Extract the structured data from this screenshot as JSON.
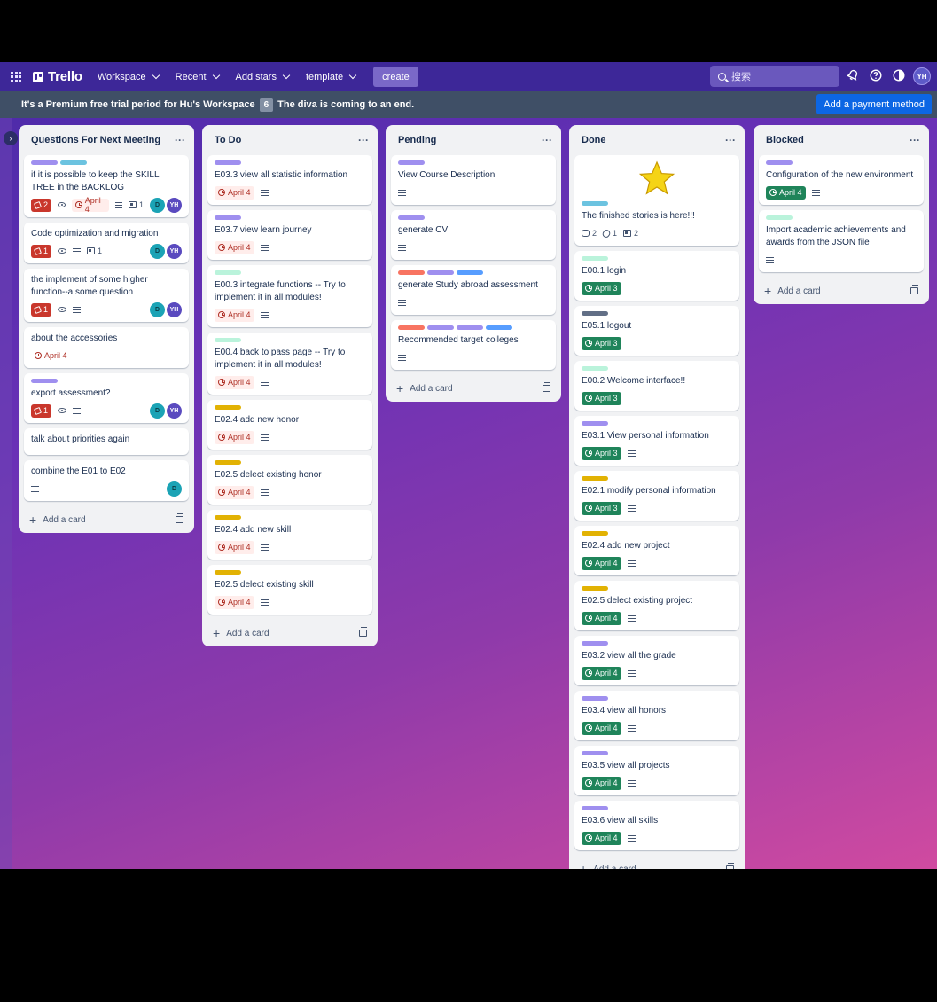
{
  "nav": {
    "logo": "Trello",
    "menu": [
      {
        "label": "Workspace"
      },
      {
        "label": "Recent"
      },
      {
        "label": "Add stars"
      },
      {
        "label": "template"
      }
    ],
    "create_label": "create",
    "search_placeholder": "搜索",
    "avatar_initials": "YH"
  },
  "banner": {
    "text": "It's a Premium free trial period for Hu's Workspace",
    "days": "6",
    "text2": "The diva is coming to an end.",
    "button": "Add a payment method"
  },
  "colors": {
    "purple": "#9f8fef",
    "teal": "#6cc3e0",
    "mint": "#baf3db",
    "yellow": "#e2b203",
    "red": "#f87462",
    "blue": "#579dff",
    "dark": "#626f86"
  },
  "add_card_label": "Add a card",
  "lists": [
    {
      "title": "Questions For Next Meeting",
      "cards": [
        {
          "labels": [
            "purple",
            "teal"
          ],
          "title": "if it is possible to keep the SKILL TREE in the BACKLOG",
          "votes": "2",
          "watch": true,
          "due": "April 4",
          "due_style": "overdue",
          "desc": true,
          "checklist": "1",
          "members": [
            "D",
            "YH"
          ]
        },
        {
          "labels": [],
          "title": "Code optimization and migration",
          "votes": "1",
          "watch": true,
          "desc": true,
          "checklist": "1",
          "members": [
            "D",
            "YH"
          ]
        },
        {
          "labels": [],
          "title": "the implement of some higher function--a some question",
          "votes": "1",
          "watch": true,
          "desc": true,
          "members": [
            "D",
            "YH"
          ]
        },
        {
          "labels": [],
          "title": "about the accessories",
          "due": "April 4",
          "due_style": "plain"
        },
        {
          "labels": [
            "purple"
          ],
          "title": "export assessment?",
          "votes": "1",
          "watch": true,
          "desc": true,
          "members": [
            "D",
            "YH"
          ]
        },
        {
          "labels": [],
          "title": "talk about priorities again"
        },
        {
          "labels": [],
          "title": "combine the E01 to E02",
          "desc": true,
          "members": [
            "D"
          ]
        }
      ]
    },
    {
      "title": "To Do",
      "cards": [
        {
          "labels": [
            "purple"
          ],
          "title": "E03.3 view all statistic information",
          "due": "April 4",
          "due_style": "overdue",
          "desc": true
        },
        {
          "labels": [
            "purple"
          ],
          "title": "E03.7 view learn journey",
          "due": "April 4",
          "due_style": "overdue",
          "desc": true
        },
        {
          "labels": [
            "mint"
          ],
          "title": "E00.3 integrate functions -- Try to implement it in all modules!",
          "due": "April 4",
          "due_style": "overdue",
          "desc": true
        },
        {
          "labels": [
            "mint"
          ],
          "title": "E00.4 back to pass page -- Try to implement it in all modules!",
          "due": "April 4",
          "due_style": "overdue",
          "desc": true
        },
        {
          "labels": [
            "yellow"
          ],
          "title": "E02.4 add new honor",
          "due": "April 4",
          "due_style": "overdue",
          "desc": true
        },
        {
          "labels": [
            "yellow"
          ],
          "title": "E02.5 delect existing honor",
          "due": "April 4",
          "due_style": "overdue",
          "desc": true
        },
        {
          "labels": [
            "yellow"
          ],
          "title": "E02.4 add new skill",
          "due": "April 4",
          "due_style": "overdue",
          "desc": true
        },
        {
          "labels": [
            "yellow"
          ],
          "title": "E02.5 delect existing skill",
          "due": "April 4",
          "due_style": "overdue",
          "desc": true
        }
      ]
    },
    {
      "title": "Pending",
      "cards": [
        {
          "labels": [
            "purple"
          ],
          "title": "View Course Description",
          "desc": true
        },
        {
          "labels": [
            "purple"
          ],
          "title": "generate CV",
          "desc": true
        },
        {
          "labels": [
            "red",
            "purple",
            "blue"
          ],
          "title": "generate Study abroad assessment",
          "desc": true
        },
        {
          "labels": [
            "red",
            "purple",
            "purple",
            "blue"
          ],
          "title": "Recommended target colleges",
          "desc": true
        }
      ]
    },
    {
      "title": "Done",
      "cards": [
        {
          "star": true,
          "labels": [
            "teal"
          ],
          "title": "The finished stories is here!!!",
          "comments": "2",
          "attachments": "1",
          "checklist": "2"
        },
        {
          "labels": [
            "mint"
          ],
          "title": "E00.1 login",
          "due": "April 3",
          "due_style": "done"
        },
        {
          "labels": [
            "dark"
          ],
          "title": "E05.1 logout",
          "due": "April 3",
          "due_style": "done"
        },
        {
          "labels": [
            "mint"
          ],
          "title": "E00.2 Welcome interface!!",
          "due": "April 3",
          "due_style": "done"
        },
        {
          "labels": [
            "purple"
          ],
          "title": "E03.1 View personal information",
          "due": "April 3",
          "due_style": "done",
          "desc": true
        },
        {
          "labels": [
            "yellow"
          ],
          "title": "E02.1 modify personal information",
          "due": "April 3",
          "due_style": "done",
          "desc": true
        },
        {
          "labels": [
            "yellow"
          ],
          "title": "E02.4 add new project",
          "due": "April 4",
          "due_style": "done",
          "desc": true
        },
        {
          "labels": [
            "yellow"
          ],
          "title": "E02.5 delect existing project",
          "due": "April 4",
          "due_style": "done",
          "desc": true
        },
        {
          "labels": [
            "purple"
          ],
          "title": "E03.2 view all the grade",
          "due": "April 4",
          "due_style": "done",
          "desc": true
        },
        {
          "labels": [
            "purple"
          ],
          "title": "E03.4 view all honors",
          "due": "April 4",
          "due_style": "done",
          "desc": true
        },
        {
          "labels": [
            "purple"
          ],
          "title": "E03.5 view all projects",
          "due": "April 4",
          "due_style": "done",
          "desc": true
        },
        {
          "labels": [
            "purple"
          ],
          "title": "E03.6 view all skills",
          "due": "April 4",
          "due_style": "done",
          "desc": true
        }
      ]
    },
    {
      "title": "Blocked",
      "cards": [
        {
          "labels": [
            "purple"
          ],
          "title": "Configuration of the new environment",
          "due": "April 4",
          "due_style": "done",
          "desc": true
        },
        {
          "labels": [
            "mint"
          ],
          "title": "Import academic achievements and awards from the JSON file",
          "desc": true
        }
      ]
    }
  ]
}
